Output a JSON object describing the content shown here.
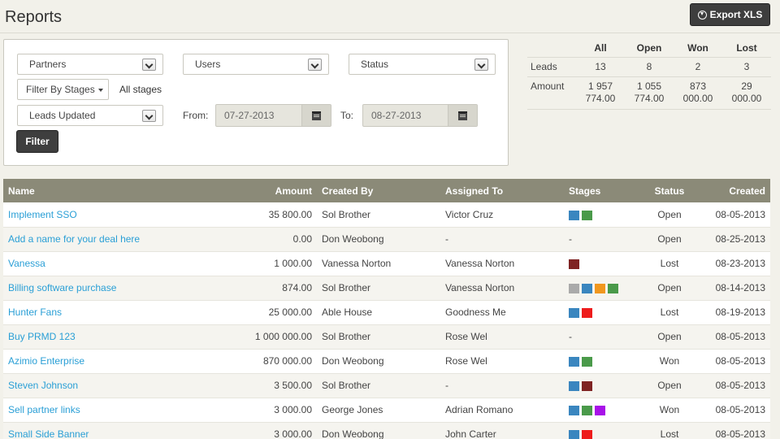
{
  "title": "Reports",
  "export_label": "Export XLS",
  "filters": {
    "partners": "Partners",
    "users": "Users",
    "status": "Status",
    "stages_button": "Filter By Stages",
    "all_stages": "All stages",
    "date_field": "Leads Updated",
    "from_label": "From:",
    "from_value": "07-27-2013",
    "to_label": "To:",
    "to_value": "08-27-2013",
    "filter_button": "Filter"
  },
  "summary": {
    "headers": [
      "All",
      "Open",
      "Won",
      "Lost"
    ],
    "leads_label": "Leads",
    "leads": [
      "13",
      "8",
      "2",
      "3"
    ],
    "amount_label": "Amount",
    "amount_line1": [
      "1 957",
      "1 055",
      "873",
      "29"
    ],
    "amount_line2": [
      "774.00",
      "774.00",
      "000.00",
      "000.00"
    ]
  },
  "stage_colors": {
    "blue": "#3a86bf",
    "green": "#4a9a4a",
    "darkred": "#7f2323",
    "grey": "#aaaaaa",
    "orange": "#f0971e",
    "red": "#ee1c1c",
    "purple": "#a812e8"
  },
  "table": {
    "columns": [
      "Name",
      "Amount",
      "Created By",
      "Assigned To",
      "Stages",
      "Status",
      "Created"
    ],
    "rows": [
      {
        "name": "Implement SSO",
        "amount": "35 800.00",
        "created_by": "Sol Brother",
        "assigned_to": "Victor Cruz",
        "stages": [
          "blue",
          "green"
        ],
        "status": "Open",
        "created": "08-05-2013"
      },
      {
        "name": "Add a name for your deal here",
        "amount": "0.00",
        "created_by": "Don Weobong",
        "assigned_to": "-",
        "stages": [],
        "status": "Open",
        "created": "08-25-2013"
      },
      {
        "name": "Vanessa",
        "amount": "1 000.00",
        "created_by": "Vanessa Norton",
        "assigned_to": "Vanessa Norton",
        "stages": [
          "darkred"
        ],
        "status": "Lost",
        "created": "08-23-2013"
      },
      {
        "name": "Billing software purchase",
        "amount": "874.00",
        "created_by": "Sol Brother",
        "assigned_to": "Vanessa Norton",
        "stages": [
          "grey",
          "blue",
          "orange",
          "green"
        ],
        "status": "Open",
        "created": "08-14-2013"
      },
      {
        "name": "Hunter Fans",
        "amount": "25 000.00",
        "created_by": "Able House",
        "assigned_to": "Goodness Me",
        "stages": [
          "blue",
          "red"
        ],
        "status": "Lost",
        "created": "08-19-2013"
      },
      {
        "name": "Buy PRMD 123",
        "amount": "1 000 000.00",
        "created_by": "Sol Brother",
        "assigned_to": "Rose Wel",
        "stages": [],
        "status": "Open",
        "created": "08-05-2013"
      },
      {
        "name": "Azimio Enterprise",
        "amount": "870 000.00",
        "created_by": "Don Weobong",
        "assigned_to": "Rose Wel",
        "stages": [
          "blue",
          "green"
        ],
        "status": "Won",
        "created": "08-05-2013"
      },
      {
        "name": "Steven Johnson",
        "amount": "3 500.00",
        "created_by": "Sol Brother",
        "assigned_to": "-",
        "stages": [
          "blue",
          "darkred"
        ],
        "status": "Open",
        "created": "08-05-2013"
      },
      {
        "name": "Sell partner links",
        "amount": "3 000.00",
        "created_by": "George Jones",
        "assigned_to": "Adrian Romano",
        "stages": [
          "blue",
          "green",
          "purple"
        ],
        "status": "Won",
        "created": "08-05-2013"
      },
      {
        "name": "Small Side Banner",
        "amount": "3 000.00",
        "created_by": "Don Weobong",
        "assigned_to": "John Carter",
        "stages": [
          "blue",
          "red"
        ],
        "status": "Lost",
        "created": "08-05-2013"
      }
    ]
  }
}
